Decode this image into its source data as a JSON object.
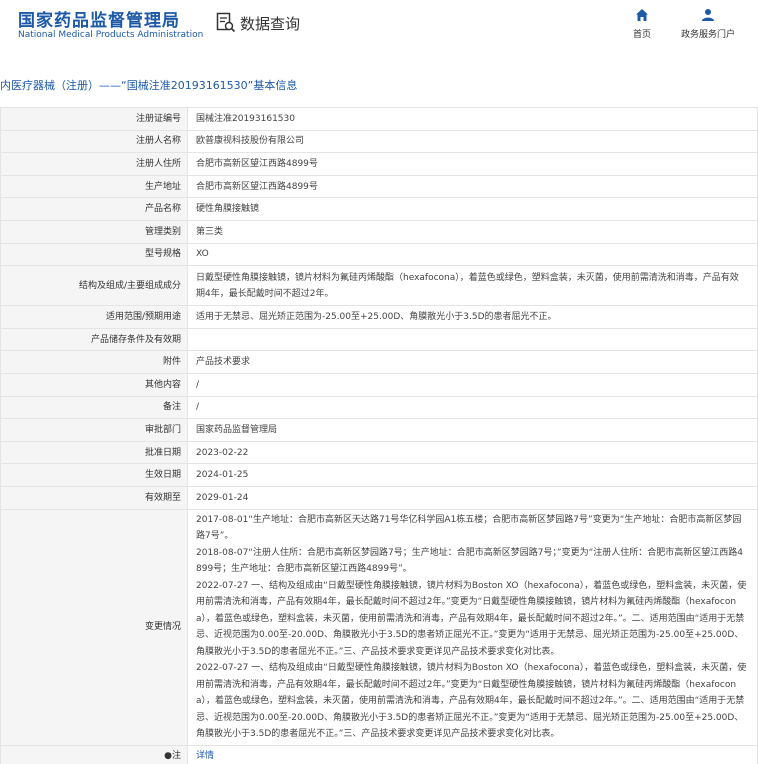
{
  "header": {
    "logo_cn": "国家药品监督管理局",
    "logo_en": "National Medical Products Administration",
    "query_title": "数据查询",
    "nav": [
      {
        "label": "首页",
        "icon": "home-icon"
      },
      {
        "label": "政务服务门户",
        "icon": "user-icon"
      }
    ],
    "brand_color": "#1c5aa8"
  },
  "page_title": "内医疗器械（注册）——“国械注准20193161530”基本信息",
  "rows": [
    {
      "label": "注册证编号",
      "value": "国械注准20193161530"
    },
    {
      "label": "注册人名称",
      "value": "欧普康视科技股份有限公司"
    },
    {
      "label": "注册人住所",
      "value": "合肥市高新区望江西路4899号"
    },
    {
      "label": "生产地址",
      "value": "合肥市高新区望江西路4899号"
    },
    {
      "label": "产品名称",
      "value": "硬性角膜接触镜"
    },
    {
      "label": "管理类别",
      "value": "第三类"
    },
    {
      "label": "型号规格",
      "value": "XO"
    },
    {
      "label": "结构及组成/主要组成成分",
      "value": "日戴型硬性角膜接触镜，镜片材料为氟硅丙烯酸酯（hexafocona），着蓝色或绿色，塑料盒装，未灭菌，使用前需清洗和消毒，产品有效期4年，最长配戴时间不超过2年。"
    },
    {
      "label": "适用范围/预期用途",
      "value": "适用于无禁忌、屈光矫正范围为-25.00至+25.00D、角膜散光小于3.5D的患者屈光不正。"
    },
    {
      "label": "产品储存条件及有效期",
      "value": ""
    },
    {
      "label": "附件",
      "value": "产品技术要求"
    },
    {
      "label": "其他内容",
      "value": "/"
    },
    {
      "label": "备注",
      "value": "/"
    },
    {
      "label": "审批部门",
      "value": "国家药品监督管理局"
    },
    {
      "label": "批准日期",
      "value": "2023-02-22"
    },
    {
      "label": "生效日期",
      "value": "2024-01-25"
    },
    {
      "label": "有效期至",
      "value": "2029-01-24"
    }
  ],
  "changes": {
    "label": "变更情况",
    "entries": [
      "2017-08-01“生产地址：合肥市高新区天达路71号华亿科学园A1栋五楼；合肥市高新区梦园路7号”变更为“生产地址：合肥市高新区梦园路7号”。",
      "2018-08-07“注册人住所：合肥市高新区梦园路7号；生产地址：合肥市高新区梦园路7号；”变更为“注册人住所：合肥市高新区望江西路4899号；生产地址：合肥市高新区望江西路4899号”。",
      "2022-07-27 一、结构及组成由“日戴型硬性角膜接触镜，镜片材料为Boston XO（hexafocona），着蓝色或绿色，塑料盒装，未灭菌，使用前需清洗和消毒，产品有效期4年，最长配戴时间不超过2年。”变更为“日戴型硬性角膜接触镜，镜片材料为氟硅丙烯酸酯（hexafocon a），着蓝色或绿色，塑料盒装，未灭菌，使用前需清洗和消毒，产品有效期4年，最长配戴时间不超过2年。”。二、适用范围由“适用于无禁忌、近视范围为0.00至-20.00D、角膜散光小于3.5D的患者矫正屈光不正。”变更为“适用于无禁忌、屈光矫正范围为-25.00至+25.00D、角膜散光小于3.5D的患者屈光不正。”三、产品技术要求变更详见产品技术要求变化对比表。",
      "2022-07-27 一、结构及组成由“日戴型硬性角膜接触镜，镜片材料为Boston XO（hexafocona），着蓝色或绿色，塑料盒装，未灭菌，使用前需清洗和消毒，产品有效期4年，最长配戴时间不超过2年。”变更为“日戴型硬性角膜接触镜，镜片材料为氟硅丙烯酸酯（hexafocon a），着蓝色或绿色，塑料盒装，未灭菌，使用前需清洗和消毒，产品有效期4年，最长配戴时间不超过2年。”。二、适用范围由“适用于无禁忌、近视范围为0.00至-20.00D、角膜散光小于3.5D的患者矫正屈光不正。”变更为“适用于无禁忌、屈光矫正范围为-25.00至+25.00D、角膜散光小于3.5D的患者屈光不正。”三、产品技术要求变更详见产品技术要求变化对比表。"
    ]
  },
  "note_row": {
    "label": "注",
    "label_prefix": "●",
    "link": "详情"
  }
}
